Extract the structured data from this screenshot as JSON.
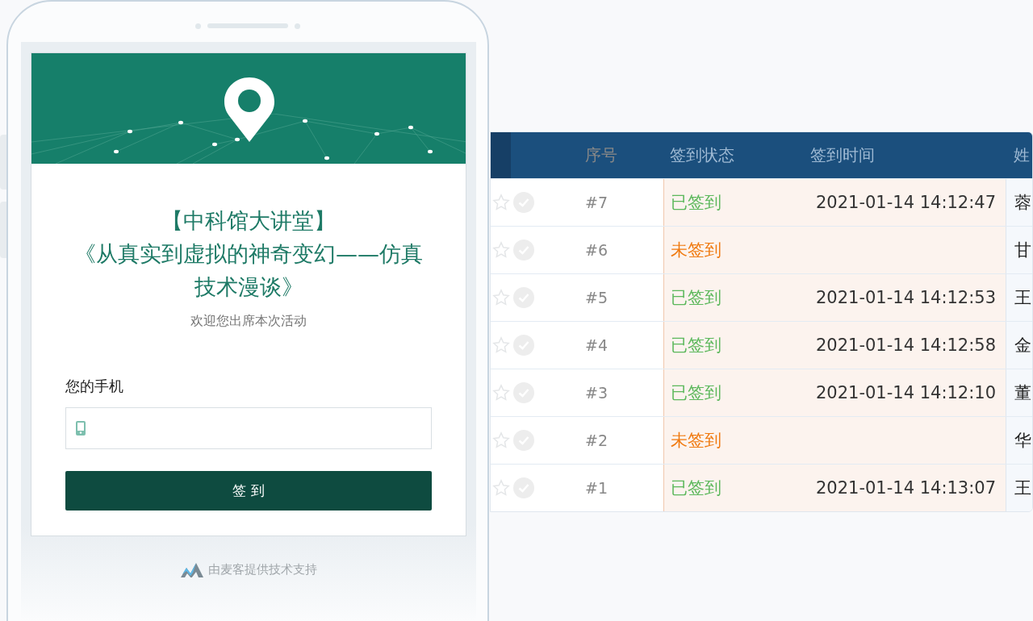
{
  "event": {
    "series": "【中科馆大讲堂】",
    "title": "《从真实到虚拟的神奇变幻——仿真技术漫谈》",
    "subtitle": "欢迎您出席本次活动"
  },
  "form": {
    "label": "您的手机",
    "submit": "签 到"
  },
  "footer": "由麦客提供技术支持",
  "table": {
    "columns": [
      "序号",
      "签到状态",
      "签到时间",
      "姓"
    ],
    "rows": [
      {
        "no": "#7",
        "signed": true,
        "status": "已签到",
        "time": "2021-01-14 14:12:47",
        "name": "蓉"
      },
      {
        "no": "#6",
        "signed": false,
        "status": "未签到",
        "name": "甘"
      },
      {
        "no": "#5",
        "signed": true,
        "status": "已签到",
        "time": "2021-01-14 14:12:53",
        "name": "王"
      },
      {
        "no": "#4",
        "signed": true,
        "status": "已签到",
        "time": "2021-01-14 14:12:58",
        "name": "金"
      },
      {
        "no": "#3",
        "signed": true,
        "status": "已签到",
        "time": "2021-01-14 14:12:10",
        "name": "董"
      },
      {
        "no": "#2",
        "signed": false,
        "status": "未签到",
        "name": "华"
      },
      {
        "no": "#1",
        "signed": true,
        "status": "已签到",
        "time": "2021-01-14 14:13:07",
        "name": "王"
      }
    ]
  }
}
